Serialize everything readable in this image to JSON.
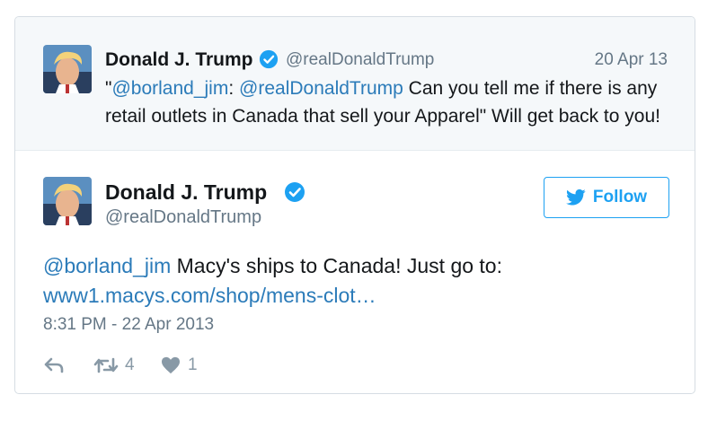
{
  "parent_tweet": {
    "author_name": "Donald J. Trump",
    "author_handle": "@realDonaldTrump",
    "date": "20 Apr 13",
    "text_parts": {
      "quote_open": "\"",
      "mention1": "@borland_jim",
      "colon": ": ",
      "mention2": "@realDonaldTrump",
      "body": " Can you tell me if there is any retail outlets in Canada that sell your Apparel\" Will get back to you!"
    }
  },
  "main_tweet": {
    "author_name": "Donald J. Trump",
    "author_handle": "@realDonaldTrump",
    "follow_label": "Follow",
    "text_parts": {
      "mention": "@borland_jim",
      "body": " Macy's ships to Canada! Just go to: ",
      "link": "www1.macys.com/shop/mens-clot…"
    },
    "timestamp": "8:31 PM - 22 Apr 2013",
    "retweet_count": "4",
    "like_count": "1"
  },
  "icons": {
    "verified": "verified-badge-icon",
    "follow": "twitter-bird-icon",
    "reply": "reply-icon",
    "retweet": "retweet-icon",
    "like": "heart-icon"
  },
  "colors": {
    "accent": "#1da1f2",
    "link": "#2b7bb9",
    "muted": "#657786",
    "parent_bg": "#f5f8fa",
    "verified": "#1da1f2"
  }
}
